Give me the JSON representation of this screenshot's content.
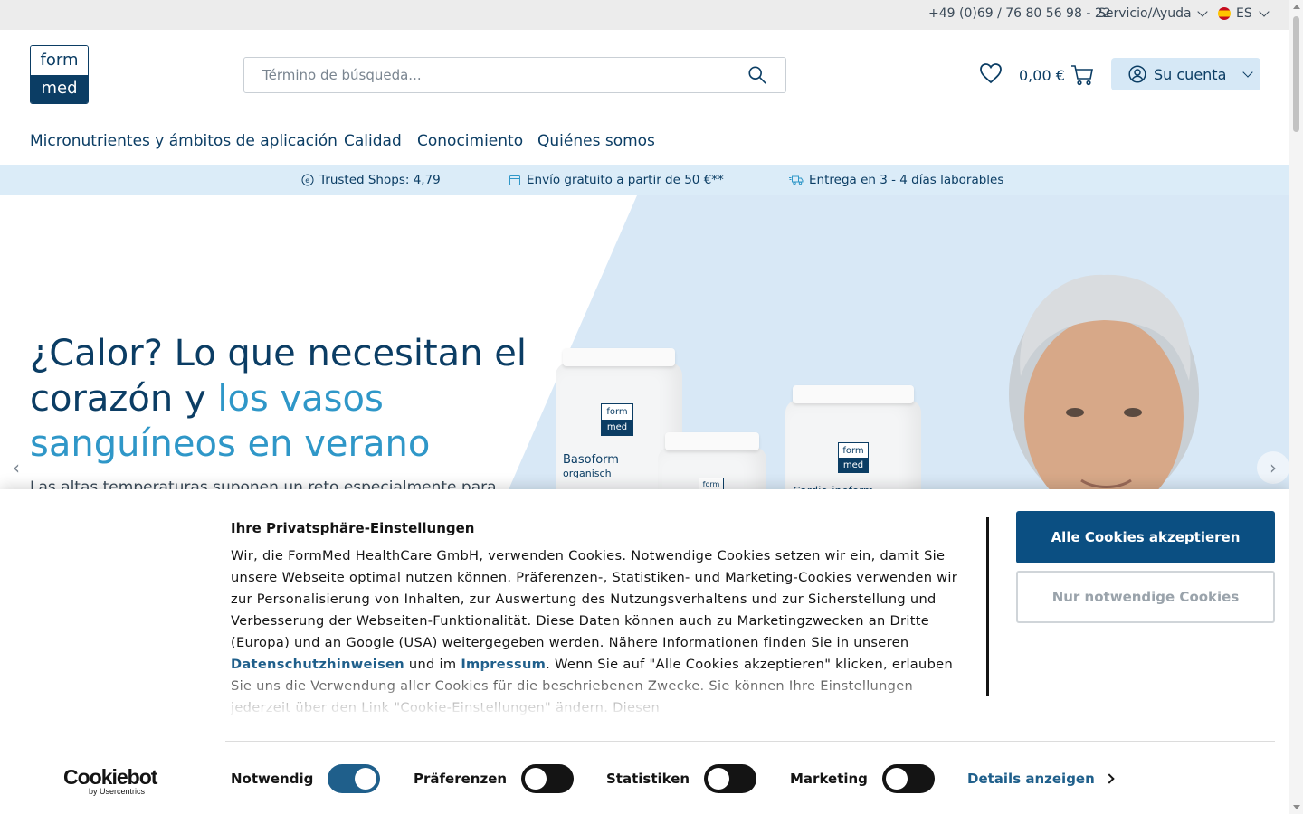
{
  "topbar": {
    "phone": "+49 (0)69 / 76 80 56 98 - 22",
    "service": "Servicio/Ayuda",
    "language": "ES"
  },
  "header": {
    "logo_top": "form",
    "logo_bottom": "med",
    "search_placeholder": "Término de búsqueda...",
    "cart_total": "0,00 €",
    "account_label": "Su cuenta"
  },
  "nav": {
    "items": [
      {
        "label": "Micronutrientes y ámbitos de aplicación"
      },
      {
        "label": "Calidad"
      },
      {
        "label": "Conocimiento"
      },
      {
        "label": "Quiénes somos"
      }
    ]
  },
  "usp": {
    "trusted": "Trusted Shops: 4,79",
    "shipping": "Envío gratuito a partir de 50 €**",
    "delivery": "Entrega en 3 - 4 días laborables"
  },
  "hero": {
    "title_part1": "¿Calor? Lo que necesitan el corazón y ",
    "title_accent": "los vasos sanguíneos en verano",
    "intro": "Las altas temperaturas suponen un reto especialmente para",
    "product1_name": "Basoform",
    "product1_sub": "organisch",
    "product3_name": "Cardio-ineform"
  },
  "cookie": {
    "title": "Ihre Privatsphäre-Einstellungen",
    "body_part1": "Wir, die FormMed HealthCare GmbH, verwenden Cookies. Notwendige Cookies setzen wir ein, damit Sie unsere Webseite optimal nutzen können. Präferenzen-, Statistiken- und Marketing-Cookies verwenden wir zur Personalisierung von Inhalten, zur Auswertung des Nutzungsverhaltens und zur Sicherstellung und Verbesserung der Webseiten-Funktionalität. Diese Daten können auch zu Marketingzwecken an Dritte (Europa) und an Google (USA) weitergegeben werden. Nähere Informationen finden Sie in unseren ",
    "link_privacy": "Datenschutzhinweisen",
    "body_part2": " und im ",
    "link_imprint": "Impressum",
    "body_part3": ". Wenn Sie auf \"Alle Cookies akzeptieren\" klicken, erlauben Sie uns die Verwendung aller Cookies für die beschriebenen Zwecke. Sie können Ihre Einstellungen jederzeit über den Link \"Cookie-Einstellungen\" ändern. Diesen",
    "accept_all": "Alle Cookies akzeptieren",
    "only_necessary": "Nur notwendige Cookies",
    "brand": "Cookiebot",
    "brand_by": "by Usercentrics",
    "toggles": [
      {
        "label": "Notwendig",
        "on": true
      },
      {
        "label": "Präferenzen",
        "on": false
      },
      {
        "label": "Statistiken",
        "on": false
      },
      {
        "label": "Marketing",
        "on": false
      }
    ],
    "details": "Details anzeigen"
  },
  "colors": {
    "brand_navy": "#0b3d64",
    "accent_blue": "#2f97c8",
    "accept_button": "#0b4f82",
    "info_strip": "#dbecf8"
  }
}
